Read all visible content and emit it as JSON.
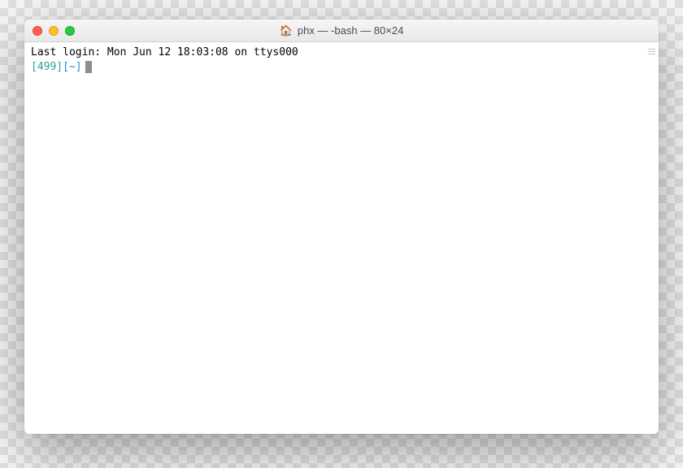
{
  "window": {
    "title_icon": "home",
    "title": "phx — -bash — 80×24"
  },
  "terminal": {
    "login_line": "Last login: Mon Jun 12 18:03:08 on ttys000",
    "prompt_num": "[499]",
    "prompt_path": "[~]"
  }
}
